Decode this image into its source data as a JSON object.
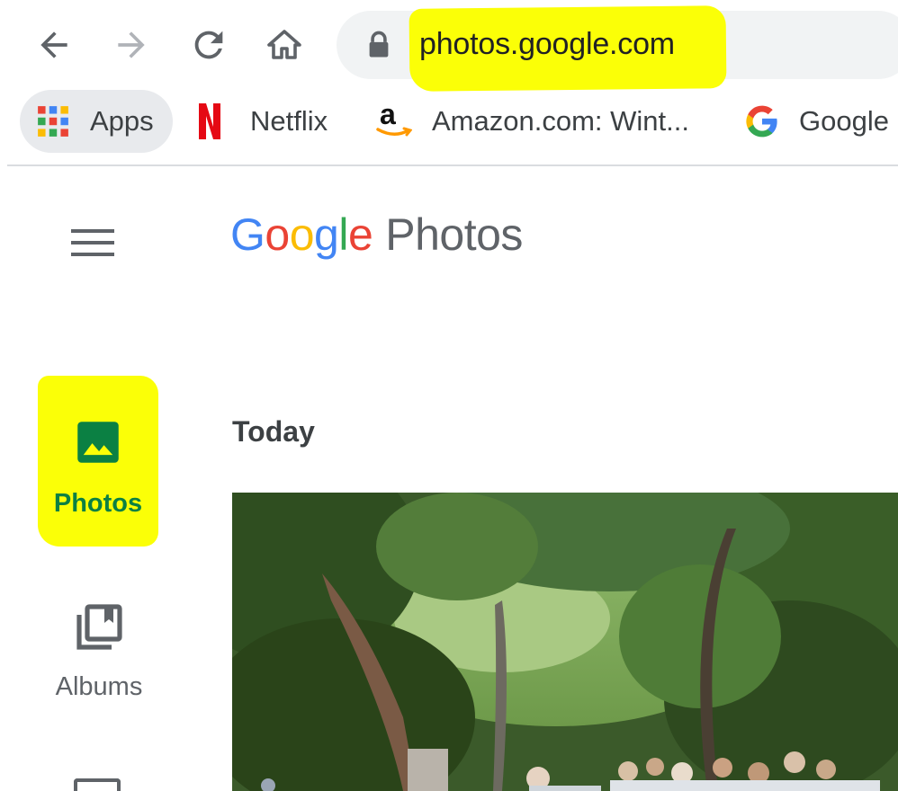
{
  "browser": {
    "toolbar": {
      "back": {
        "icon": "arrow-left-icon"
      },
      "forward": {
        "icon": "arrow-right-icon"
      },
      "reload": {
        "icon": "reload-icon"
      },
      "home": {
        "icon": "home-icon"
      }
    },
    "address_bar": {
      "lock_icon": "lock-icon",
      "url": "photos.google.com",
      "highlight_color": "#fbff07"
    },
    "bookmarks": [
      {
        "label": "Apps",
        "icon": "apps-grid-icon"
      },
      {
        "label": "Netflix",
        "icon": "netflix-icon"
      },
      {
        "label": "Amazon.com: Wint...",
        "icon": "amazon-icon"
      },
      {
        "label": "Google",
        "icon": "google-icon"
      }
    ]
  },
  "app": {
    "logo": {
      "brand": [
        "G",
        "o",
        "o",
        "g",
        "l",
        "e"
      ],
      "product": "Photos"
    },
    "menu_icon": "hamburger-menu-icon",
    "sidebar": {
      "items": [
        {
          "label": "Photos",
          "icon": "photo-icon",
          "active": true,
          "color": "#0b8043"
        },
        {
          "label": "Albums",
          "icon": "albums-icon",
          "active": false,
          "color": "#5f6368"
        }
      ]
    },
    "main": {
      "section_heading": "Today",
      "photo": {
        "subject": "photo-thumbnail"
      }
    }
  },
  "colors": {
    "highlight": "#fbff07",
    "active_nav": "#0b8043",
    "google_blue": "#4285f4",
    "google_red": "#ea4335",
    "google_yellow": "#fbbc05",
    "google_green": "#34a853"
  }
}
